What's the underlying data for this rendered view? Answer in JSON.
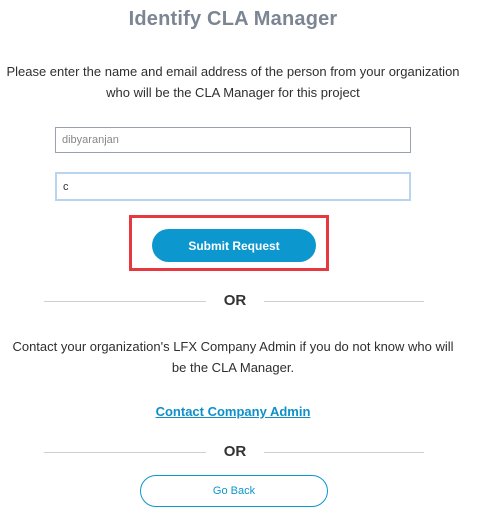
{
  "header": {
    "title": "Identify CLA Manager"
  },
  "intro": {
    "line1": "Please enter the name and email address of the person from your organization",
    "line2": "who will be the CLA Manager for this project"
  },
  "form": {
    "name_value": "dibyaranjan",
    "email_value": "c"
  },
  "actions": {
    "submit_label": "Submit Request",
    "or_label_1": "OR",
    "or_label_2": "OR",
    "go_back_label": "Go Back"
  },
  "contact": {
    "line1": "Contact your organization's LFX Company Admin if you do not know who will",
    "line2": "be the CLA Manager.",
    "link_label": "Contact Company Admin"
  },
  "colors": {
    "accent": "#0c97cf",
    "highlight_border": "#e5383f",
    "title": "#7c8593"
  }
}
